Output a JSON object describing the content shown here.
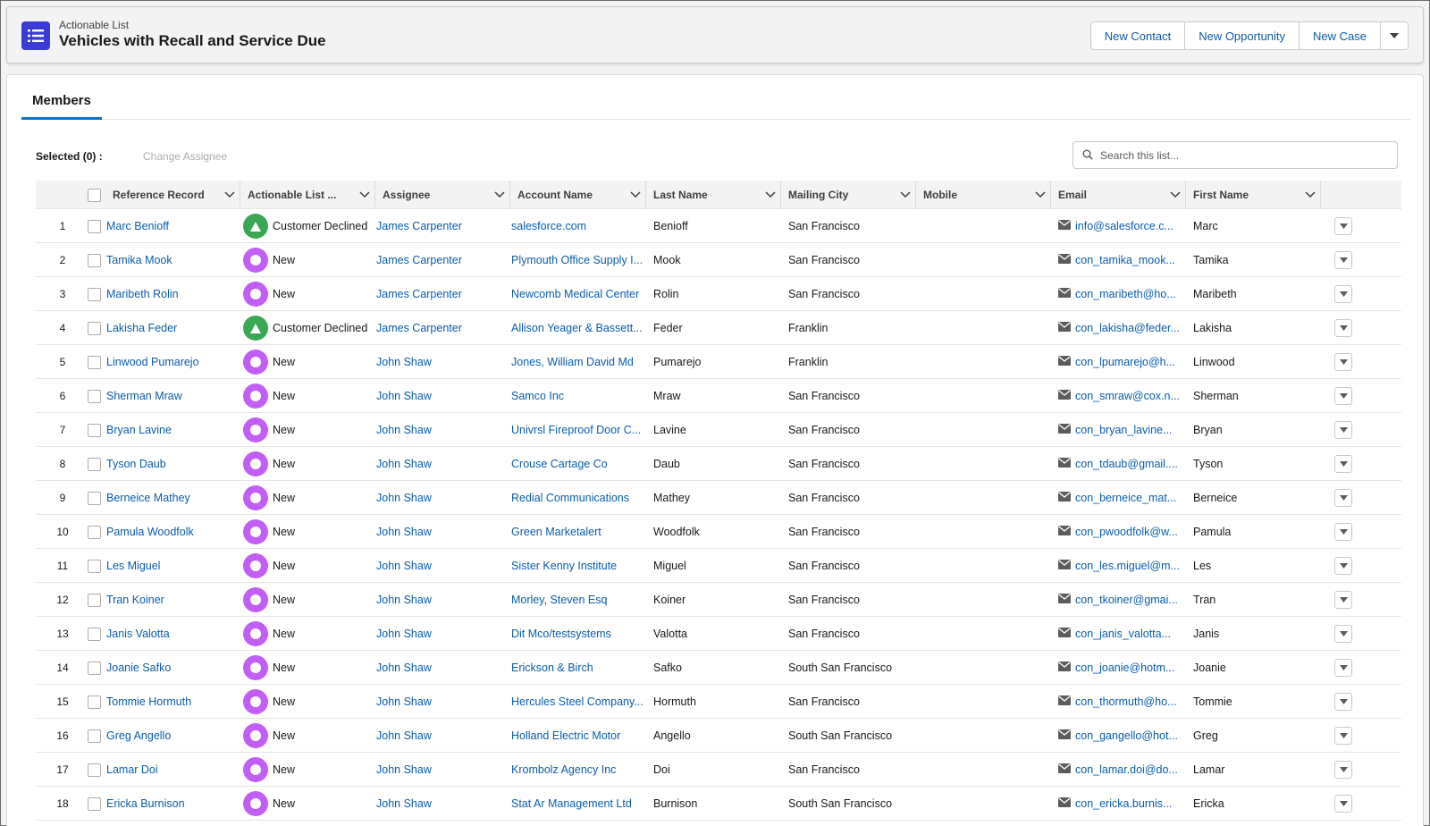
{
  "header": {
    "eyebrow": "Actionable List",
    "title": "Vehicles with Recall and Service Due",
    "buttons": [
      "New Contact",
      "New Opportunity",
      "New Case"
    ]
  },
  "tabs": {
    "active": "Members"
  },
  "toolbar": {
    "selected_label": "Selected (0) :",
    "change_assignee": "Change Assignee",
    "search_placeholder": "Search this list..."
  },
  "colors": {
    "status_new": "#c05ef5",
    "status_declined": "#3ba755",
    "link": "#0b5cab",
    "brand_icon": "#3b3bd6"
  },
  "table": {
    "columns": [
      "Reference Record",
      "Actionable List ...",
      "Assignee",
      "Account Name",
      "Last Name",
      "Mailing City",
      "Mobile",
      "Email",
      "First Name"
    ],
    "rows": [
      {
        "n": "1",
        "ref": "Marc Benioff",
        "status": "Customer Declined",
        "icon": "triangle-icon",
        "assignee": "James Carpenter",
        "account": "salesforce.com",
        "last": "Benioff",
        "city": "San Francisco",
        "mobile": "",
        "email": "info@salesforce.c...",
        "first": "Marc"
      },
      {
        "n": "2",
        "ref": "Tamika Mook",
        "status": "New",
        "icon": "circle-icon",
        "assignee": "James Carpenter",
        "account": "Plymouth Office Supply I...",
        "last": "Mook",
        "city": "San Francisco",
        "mobile": "",
        "email": "con_tamika_mook...",
        "first": "Tamika"
      },
      {
        "n": "3",
        "ref": "Maribeth Rolin",
        "status": "New",
        "icon": "circle-icon",
        "assignee": "James Carpenter",
        "account": "Newcomb Medical Center",
        "last": "Rolin",
        "city": "San Francisco",
        "mobile": "",
        "email": "con_maribeth@ho...",
        "first": "Maribeth"
      },
      {
        "n": "4",
        "ref": "Lakisha Feder",
        "status": "Customer Declined",
        "icon": "triangle-icon",
        "assignee": "James Carpenter",
        "account": "Allison Yeager & Bassett...",
        "last": "Feder",
        "city": "Franklin",
        "mobile": "",
        "email": "con_lakisha@feder...",
        "first": "Lakisha"
      },
      {
        "n": "5",
        "ref": "Linwood Pumarejo",
        "status": "New",
        "icon": "circle-icon",
        "assignee": "John Shaw",
        "account": "Jones, William David Md",
        "last": "Pumarejo",
        "city": "Franklin",
        "mobile": "",
        "email": "con_lpumarejo@h...",
        "first": "Linwood"
      },
      {
        "n": "6",
        "ref": "Sherman Mraw",
        "status": "New",
        "icon": "circle-icon",
        "assignee": "John Shaw",
        "account": "Samco Inc",
        "last": "Mraw",
        "city": "San Francisco",
        "mobile": "",
        "email": "con_smraw@cox.n...",
        "first": "Sherman"
      },
      {
        "n": "7",
        "ref": "Bryan Lavine",
        "status": "New",
        "icon": "circle-icon",
        "assignee": "John Shaw",
        "account": "Univrsl Fireproof Door C...",
        "last": "Lavine",
        "city": "San Francisco",
        "mobile": "",
        "email": "con_bryan_lavine...",
        "first": "Bryan"
      },
      {
        "n": "8",
        "ref": "Tyson Daub",
        "status": "New",
        "icon": "circle-icon",
        "assignee": "John Shaw",
        "account": "Crouse Cartage Co",
        "last": "Daub",
        "city": "San Francisco",
        "mobile": "",
        "email": "con_tdaub@gmail....",
        "first": "Tyson"
      },
      {
        "n": "9",
        "ref": "Berneice Mathey",
        "status": "New",
        "icon": "circle-icon",
        "assignee": "John Shaw",
        "account": "Redial Communications",
        "last": "Mathey",
        "city": "San Francisco",
        "mobile": "",
        "email": "con_berneice_mat...",
        "first": "Berneice"
      },
      {
        "n": "10",
        "ref": "Pamula Woodfolk",
        "status": "New",
        "icon": "circle-icon",
        "assignee": "John Shaw",
        "account": "Green Marketalert",
        "last": "Woodfolk",
        "city": "San Francisco",
        "mobile": "",
        "email": "con_pwoodfolk@w...",
        "first": "Pamula"
      },
      {
        "n": "11",
        "ref": "Les Miguel",
        "status": "New",
        "icon": "circle-icon",
        "assignee": "John Shaw",
        "account": "Sister Kenny Institute",
        "last": "Miguel",
        "city": "San Francisco",
        "mobile": "",
        "email": "con_les.miguel@m...",
        "first": "Les"
      },
      {
        "n": "12",
        "ref": "Tran Koiner",
        "status": "New",
        "icon": "circle-icon",
        "assignee": "John Shaw",
        "account": "Morley, Steven Esq",
        "last": "Koiner",
        "city": "San Francisco",
        "mobile": "",
        "email": "con_tkoiner@gmai...",
        "first": "Tran"
      },
      {
        "n": "13",
        "ref": "Janis Valotta",
        "status": "New",
        "icon": "circle-icon",
        "assignee": "John Shaw",
        "account": "Dit Mco/testsystems",
        "last": "Valotta",
        "city": "San Francisco",
        "mobile": "",
        "email": "con_janis_valotta...",
        "first": "Janis"
      },
      {
        "n": "14",
        "ref": "Joanie Safko",
        "status": "New",
        "icon": "circle-icon",
        "assignee": "John Shaw",
        "account": "Erickson & Birch",
        "last": "Safko",
        "city": "South San Francisco",
        "mobile": "",
        "email": "con_joanie@hotm...",
        "first": "Joanie"
      },
      {
        "n": "15",
        "ref": "Tommie Hormuth",
        "status": "New",
        "icon": "circle-icon",
        "assignee": "John Shaw",
        "account": "Hercules Steel Company...",
        "last": "Hormuth",
        "city": "San Francisco",
        "mobile": "",
        "email": "con_thormuth@ho...",
        "first": "Tommie"
      },
      {
        "n": "16",
        "ref": "Greg Angello",
        "status": "New",
        "icon": "circle-icon",
        "assignee": "John Shaw",
        "account": "Holland Electric Motor",
        "last": "Angello",
        "city": "South San Francisco",
        "mobile": "",
        "email": "con_gangello@hot...",
        "first": "Greg"
      },
      {
        "n": "17",
        "ref": "Lamar Doi",
        "status": "New",
        "icon": "circle-icon",
        "assignee": "John Shaw",
        "account": "Krombolz Agency Inc",
        "last": "Doi",
        "city": "San Francisco",
        "mobile": "",
        "email": "con_lamar.doi@do...",
        "first": "Lamar"
      },
      {
        "n": "18",
        "ref": "Ericka Burnison",
        "status": "New",
        "icon": "circle-icon",
        "assignee": "John Shaw",
        "account": "Stat Ar Management Ltd",
        "last": "Burnison",
        "city": "South San Francisco",
        "mobile": "",
        "email": "con_ericka.burnis...",
        "first": "Ericka"
      }
    ]
  }
}
